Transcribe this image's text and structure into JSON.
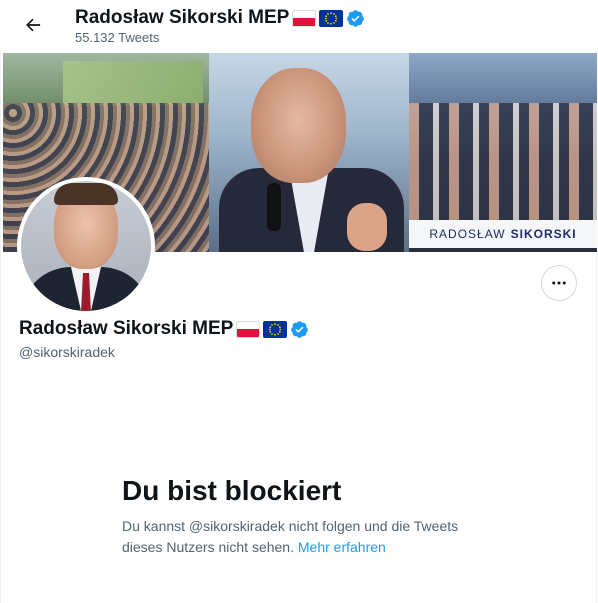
{
  "header": {
    "back_icon": "arrow-left-icon",
    "name": "Radosław Sikorski MEP",
    "tweet_count": "55.132 Tweets",
    "flags": [
      "flag-poland-icon",
      "flag-eu-icon"
    ],
    "verified_icon": "verified-badge-icon"
  },
  "banner": {
    "caption_first": "RADOSŁAW",
    "caption_last": "SIKORSKI"
  },
  "profile": {
    "name": "Radosław Sikorski MEP",
    "handle": "@sikorskiradek",
    "more_icon": "more-dots-icon"
  },
  "blocked": {
    "title": "Du bist blockiert",
    "message": "Du kannst @sikorskiradek nicht folgen und die Tweets dieses Nutzers nicht sehen.",
    "link": "Mehr erfahren"
  },
  "colors": {
    "accent": "#1d9bf0",
    "text_primary": "#0f1419",
    "text_secondary": "#536471",
    "border": "#cfd9de"
  }
}
